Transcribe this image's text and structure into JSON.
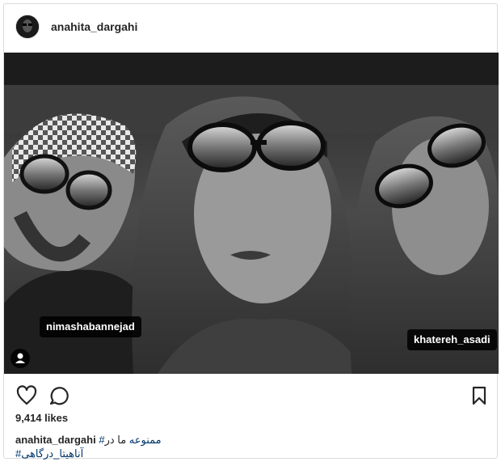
{
  "post": {
    "username": "anahita_dargahi",
    "tags": [
      "nimashabannejad",
      "khatereh_asadi"
    ],
    "likes": "9,414 likes",
    "caption_user": "anahita_dargahi",
    "caption_text": "ما در",
    "caption_hashtag1": "#ممنوعه",
    "caption_hashtag2": "#آناهیتا_درگاهی"
  },
  "icons": {
    "like": "heart-icon",
    "comment": "comment-icon",
    "save": "bookmark-icon",
    "user_tag": "user-tag-icon"
  },
  "colors": {
    "border": "#dbdbdb",
    "text": "#262626",
    "hashtag": "#003569",
    "tag_bg": "#000000"
  }
}
